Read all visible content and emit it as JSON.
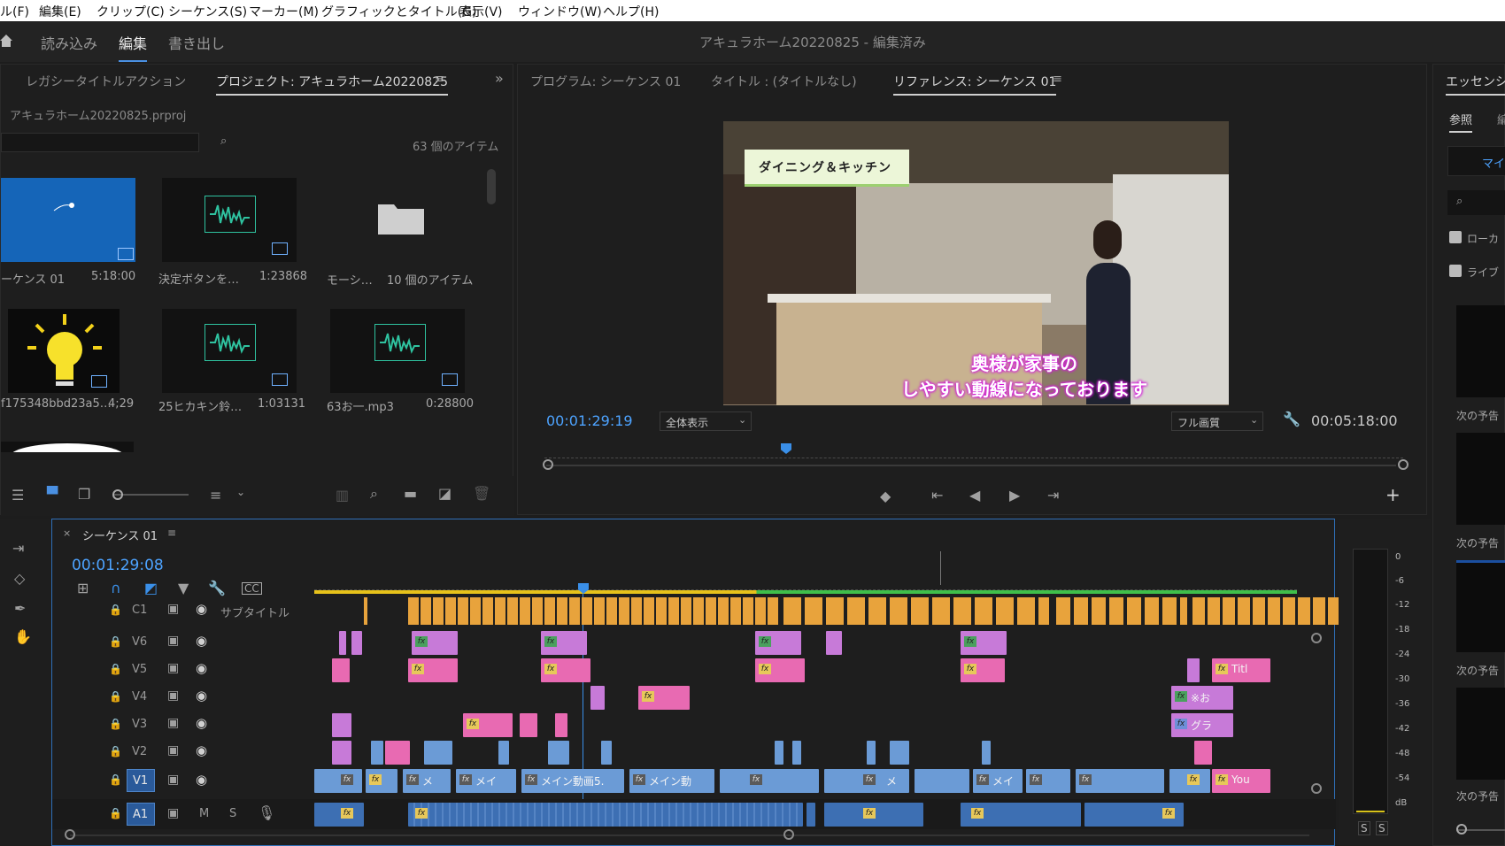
{
  "menu": [
    "ル(F)",
    "編集(E)",
    "クリップ(C)",
    "シーケンス(S)",
    "マーカー(M)",
    "グラフィックとタイトル(G)",
    "表示(V)",
    "ウィンドウ(W)",
    "ヘルプ(H)"
  ],
  "workspace_tabs": [
    "読み込み",
    "編集",
    "書き出し"
  ],
  "document_title": "アキュラホーム20220825 - 編集済み",
  "project_panel": {
    "tab_legacy": "レガシータイトルアクション",
    "tab_project": "プロジェクト: アキュラホーム20220825",
    "file": "アキュラホーム20220825.prproj",
    "item_count": "63 個のアイテム",
    "items": [
      {
        "name": "ーケンス 01",
        "meta": "5:18:00"
      },
      {
        "name": "決定ボタンを…",
        "meta": "1:23868"
      },
      {
        "name": "モーシ…",
        "meta": "10 個のアイテム"
      },
      {
        "name": "f175348bbd23a5…",
        "meta": "4;29"
      },
      {
        "name": "25ヒカキン鈴…",
        "meta": "1:03131"
      },
      {
        "name": "63お一.mp3",
        "meta": "0:28800"
      }
    ]
  },
  "monitor": {
    "tab_program": "プログラム: シーケンス 01",
    "tab_title": "タイトル : (タイトルなし)",
    "tab_reference": "リファレンス: シーケンス 01",
    "overlay_title": "ダイニング＆キッチン",
    "subtitle_line1": "奥様が家事の",
    "subtitle_line2": "しやすい動線になっております",
    "timecode": "00:01:29:19",
    "fit": "全体表示",
    "quality": "フル画質",
    "duration": "00:05:18:00"
  },
  "essentials": {
    "title": "エッセンシ",
    "tab": "参照",
    "tab2": "編",
    "button": "マイ",
    "check1": "ローカ",
    "check2": "ライブ",
    "next_label": "次の予告"
  },
  "timeline": {
    "title": "シーケンス 01",
    "timecode": "00:01:29:08",
    "tracks": [
      {
        "id": "C1",
        "name": "サブタイトル"
      },
      {
        "id": "V6",
        "name": ""
      },
      {
        "id": "V5",
        "name": ""
      },
      {
        "id": "V4",
        "name": ""
      },
      {
        "id": "V3",
        "name": ""
      },
      {
        "id": "V2",
        "name": ""
      },
      {
        "id": "V1",
        "name": ""
      },
      {
        "id": "A1",
        "name": ""
      }
    ],
    "clip_labels": {
      "v5_end": "Titl",
      "v4_end": "※お",
      "v3_end": "グラ",
      "v1_a": "メ",
      "v1_b": "メイ",
      "v1_c": "メイン動画5.",
      "v1_d": "メイン動",
      "v1_e": "メ",
      "v1_f": "メイ",
      "v1_end": "You"
    },
    "audio_controls": [
      "M",
      "S"
    ],
    "meter_scale": [
      "0",
      "-6",
      "-12",
      "-18",
      "-24",
      "-30",
      "-36",
      "-42",
      "-48",
      "-54",
      "dB"
    ],
    "solo": [
      "S",
      "S"
    ]
  },
  "colors": {
    "accent_blue": "#4da3ff",
    "clip_v1": "#6b9bd6",
    "clip_pink": "#e86ab2",
    "clip_violet": "#c77ad8",
    "subtitle_orange": "#e8a33c"
  }
}
